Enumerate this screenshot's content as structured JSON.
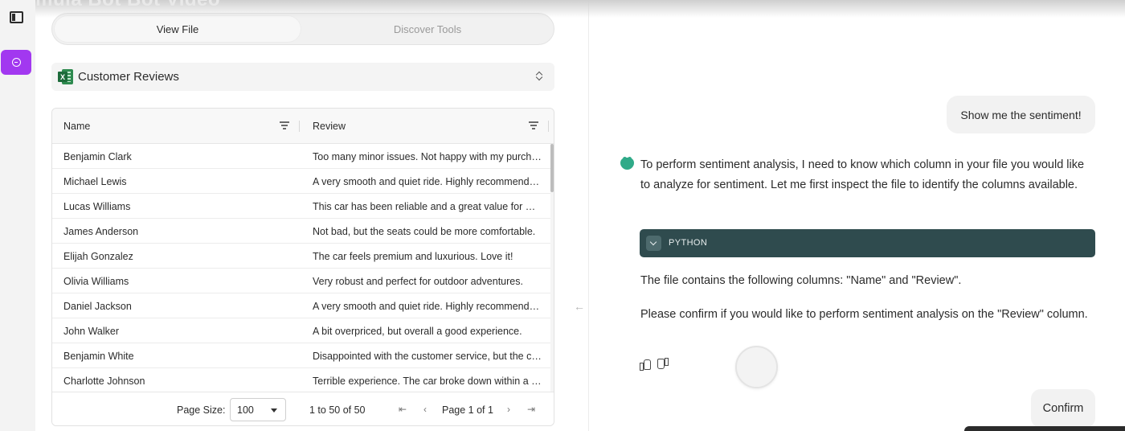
{
  "overlay_title": "Formula Bot Bot Video",
  "rail": {
    "toggle_icon": "sidebar-toggle-icon",
    "chat_icon": "chat-bubble-icon",
    "accent": "#a238f0"
  },
  "tabs": {
    "view_file": "View File",
    "discover_tools": "Discover Tools"
  },
  "file": {
    "name": "Customer Reviews",
    "icon": "excel-icon"
  },
  "grid": {
    "columns": [
      "Name",
      "Review"
    ],
    "rows": [
      {
        "name": "Benjamin Clark",
        "review": "Too many minor issues. Not happy with my purchase."
      },
      {
        "name": "Michael Lewis",
        "review": "A very smooth and quiet ride. Highly recommended."
      },
      {
        "name": "Lucas Williams",
        "review": "This car has been reliable and a great value for money."
      },
      {
        "name": "James Anderson",
        "review": "Not bad, but the seats could be more comfortable."
      },
      {
        "name": "Elijah Gonzalez",
        "review": "The car feels premium and luxurious. Love it!"
      },
      {
        "name": "Olivia Williams",
        "review": "Very robust and perfect for outdoor adventures."
      },
      {
        "name": "Daniel Jackson",
        "review": "A very smooth and quiet ride. Highly recommended."
      },
      {
        "name": "John Walker",
        "review": "A bit overpriced, but overall a good experience."
      },
      {
        "name": "Benjamin White",
        "review": "Disappointed with the customer service, but the car is fine."
      },
      {
        "name": "Charlotte Johnson",
        "review": "Terrible experience. The car broke down within a week."
      }
    ],
    "footer": {
      "page_size_label": "Page Size:",
      "page_size_value": "100",
      "range": "1 to 50 of 50",
      "page_label": "Page 1 of 1",
      "first": "⇤",
      "prev": "‹",
      "next": "›",
      "last": "⇥"
    }
  },
  "chat": {
    "user_message": "Show me the sentiment!",
    "bot_p1": "To perform sentiment analysis, I need to know which column in your file you would like to analyze for sentiment. Let me first inspect the file to identify the columns available.",
    "code_lang": "PYTHON",
    "bot_p2": "The file contains the following columns: \"Name\" and \"Review\".",
    "bot_p3": "Please confirm if you would like to perform sentiment analysis on the \"Review\" column.",
    "confirm_label": "Confirm",
    "code_bar_color": "#2f4b4e",
    "avatar_color": "#2faa88"
  }
}
